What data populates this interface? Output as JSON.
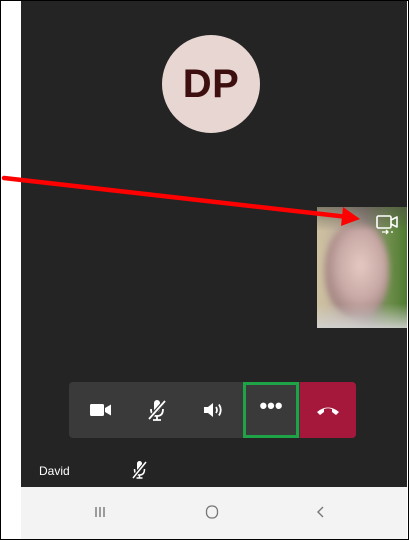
{
  "call": {
    "avatar_initials": "DP",
    "participant_name": "David"
  },
  "controls": {
    "camera_icon": "video-camera-icon",
    "mic_icon": "mic-muted-icon",
    "speaker_icon": "speaker-icon",
    "more_label": "•••",
    "end_icon": "phone-hangup-icon"
  },
  "self_view": {
    "switch_icon": "switch-camera-icon"
  },
  "nav": {
    "recents_icon": "recent-apps-icon",
    "home_icon": "home-icon",
    "back_icon": "back-chevron-icon"
  },
  "colors": {
    "call_background": "#242424",
    "avatar_bg": "#e8d6d3",
    "avatar_text": "#3d0f0f",
    "end_call": "#a5183b",
    "highlight": "#1ea447",
    "annotation_arrow": "#ff0000"
  }
}
